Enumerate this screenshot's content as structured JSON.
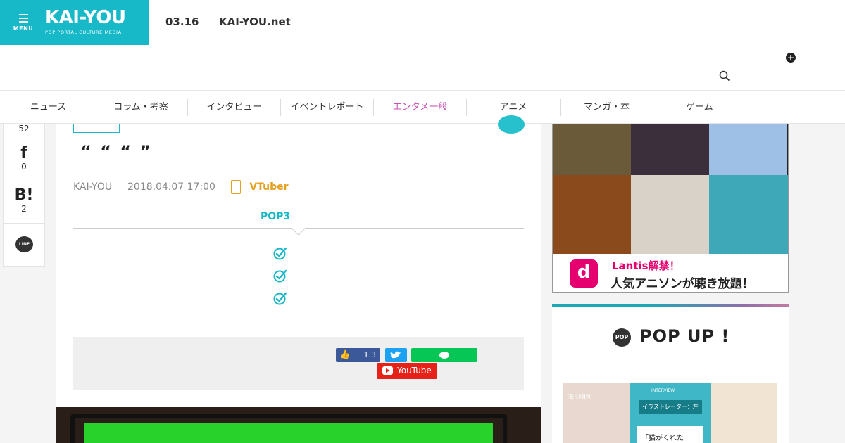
{
  "header": {
    "menu_label": "MENU",
    "logo": "KAI-YOU",
    "logo_sub": "POP PORTAL CULTURE MEDIA",
    "date": "03.16",
    "site": "KAI-YOU.net"
  },
  "nav": {
    "items": [
      "ニュース",
      "コラム・考察",
      "インタビュー",
      "イベントレポート",
      "エンタメ一般",
      "アニメ",
      "マンガ・本",
      "ゲーム"
    ],
    "active_index": 4
  },
  "share_rail": {
    "top_count": "52",
    "facebook_icon": "f",
    "facebook_count": "0",
    "hatena_icon": "B!",
    "hatena_count": "2",
    "line_icon": "LINE"
  },
  "article": {
    "title": "“ “ “ ”",
    "author": "KAI-YOU",
    "datetime": "2018.04.07 17:00",
    "tag": "VTuber",
    "pop3_heading": "POP3",
    "like_count": "1.3",
    "youtube_label": "YouTube"
  },
  "sidebar": {
    "ad_line1": "Lantis解禁！",
    "ad_line2": "人気アニソンが聴き放題！",
    "ad_badge": "d",
    "popup_badge": "POP",
    "popup_title": "POP UP !",
    "popup_card_header": "イラストレーター：左",
    "popup_card_text": "「猫がくれた",
    "popup_interview_label": "INTERVIEW",
    "popup_left_label": "TERMIN"
  },
  "colors": {
    "brand": "#17b9c8",
    "nav_active": "#c94fb3",
    "tag": "#e6a020",
    "facebook": "#3b5998",
    "twitter": "#1da1f2",
    "line": "#06c755",
    "youtube": "#e62117"
  }
}
